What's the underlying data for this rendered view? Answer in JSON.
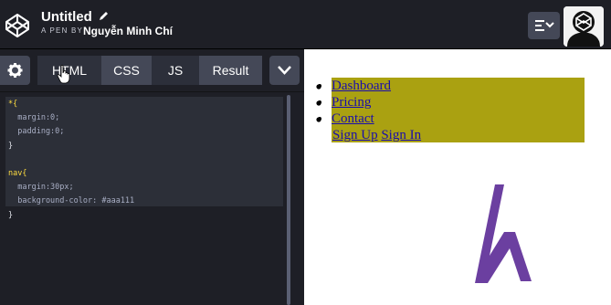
{
  "header": {
    "title": "Untitled",
    "byline": "A PEN BY",
    "author": "Nguyễn Minh Chí"
  },
  "editor": {
    "tabs": [
      {
        "label": "HTML"
      },
      {
        "label": "CSS"
      },
      {
        "label": "JS"
      },
      {
        "label": "Result"
      }
    ],
    "active_tab": "CSS",
    "css_code": [
      "*{",
      "  margin:0;",
      "  padding:0;",
      "}",
      "",
      "nav{",
      "  margin:30px;",
      "  background-color: #aaa111",
      "}"
    ]
  },
  "preview": {
    "nav_links": [
      "Dashboard",
      "Pricing",
      "Contact"
    ],
    "extra_links": [
      "Sign Up",
      "Sign In"
    ],
    "nav_background": "#aaa111"
  },
  "colors": {
    "header_bg": "#1e1f26",
    "tab_bg": "#444857",
    "accent_purple": "#6b3fa0"
  },
  "icons": [
    "codepen-logo-icon",
    "pencil-icon",
    "layout-toggle-icon",
    "avatar-icon",
    "gear-icon",
    "chevron-down-icon",
    "cursor-icon",
    "h-logo-icon"
  ]
}
